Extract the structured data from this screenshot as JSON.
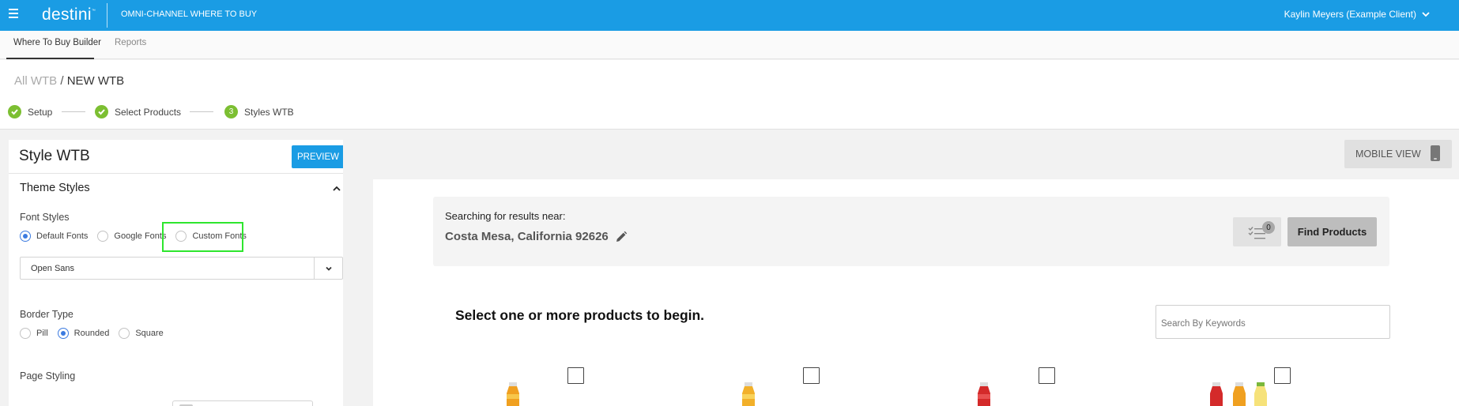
{
  "topbar": {
    "logo": "destini",
    "logo_tm": "™",
    "app_title": "OMNI-CHANNEL WHERE TO BUY",
    "user": "Kaylin Meyers (Example Client)"
  },
  "tabs": [
    {
      "label": "Where To Buy Builder",
      "active": true
    },
    {
      "label": "Reports",
      "active": false
    }
  ],
  "breadcrumb": {
    "link": "All WTB",
    "separator": "/",
    "current": "NEW WTB"
  },
  "steps": [
    {
      "label": "Setup",
      "status": "done"
    },
    {
      "label": "Select Products",
      "status": "done"
    },
    {
      "label": "Styles WTB",
      "status": "current",
      "number": "3"
    }
  ],
  "left_panel": {
    "title": "Style WTB",
    "preview_label": "PREVIEW",
    "section_title": "Theme Styles",
    "font_styles": {
      "label": "Font Styles",
      "options": [
        "Default Fonts",
        "Google Fonts",
        "Custom Fonts"
      ],
      "selected": "Default Fonts",
      "font_value": "Open Sans"
    },
    "border_type": {
      "label": "Border Type",
      "options": [
        "Pill",
        "Rounded",
        "Square"
      ],
      "selected": "Rounded"
    },
    "page_styling_label": "Page Styling"
  },
  "mobile_view_label": "MOBILE VIEW",
  "preview": {
    "near_label": "Searching for results near:",
    "location": "Costa Mesa, California 92626",
    "list_count": "0",
    "find_label": "Find Products",
    "select_heading": "Select one or more products to begin.",
    "keyword_placeholder": "Search By Keywords"
  },
  "colors": {
    "brand_blue": "#1a9ce4",
    "step_green": "#7cbf32",
    "highlight_green": "#2ee62e",
    "radio_blue": "#3c7be0"
  }
}
